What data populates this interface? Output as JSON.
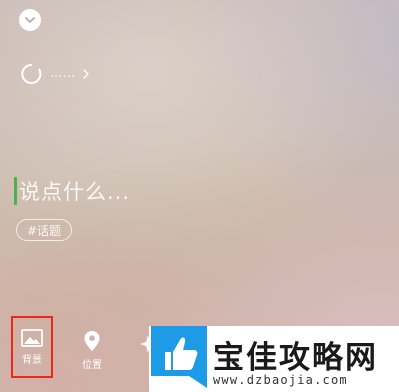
{
  "header": {
    "collapse_icon": "chevron-down-icon"
  },
  "status": {
    "text": "……",
    "spinner_icon": "loading-spinner-icon",
    "chevron_icon": "chevron-right-icon"
  },
  "compose": {
    "placeholder": "说点什么...",
    "cursor_color": "#4caf50"
  },
  "topic": {
    "label": "#话题"
  },
  "toolbar": {
    "background_label": "背景",
    "background_icon": "image-icon",
    "location_label": "位置",
    "location_icon": "location-pin-icon",
    "more_icon": "sparkle-icon",
    "highlight_color": "#e8291c"
  },
  "watermark": {
    "title": "宝佳攻略网",
    "url": "www.dzbaojia.com",
    "logo_icon": "thumbs-up-icon",
    "logo_color": "#1e9be6"
  }
}
